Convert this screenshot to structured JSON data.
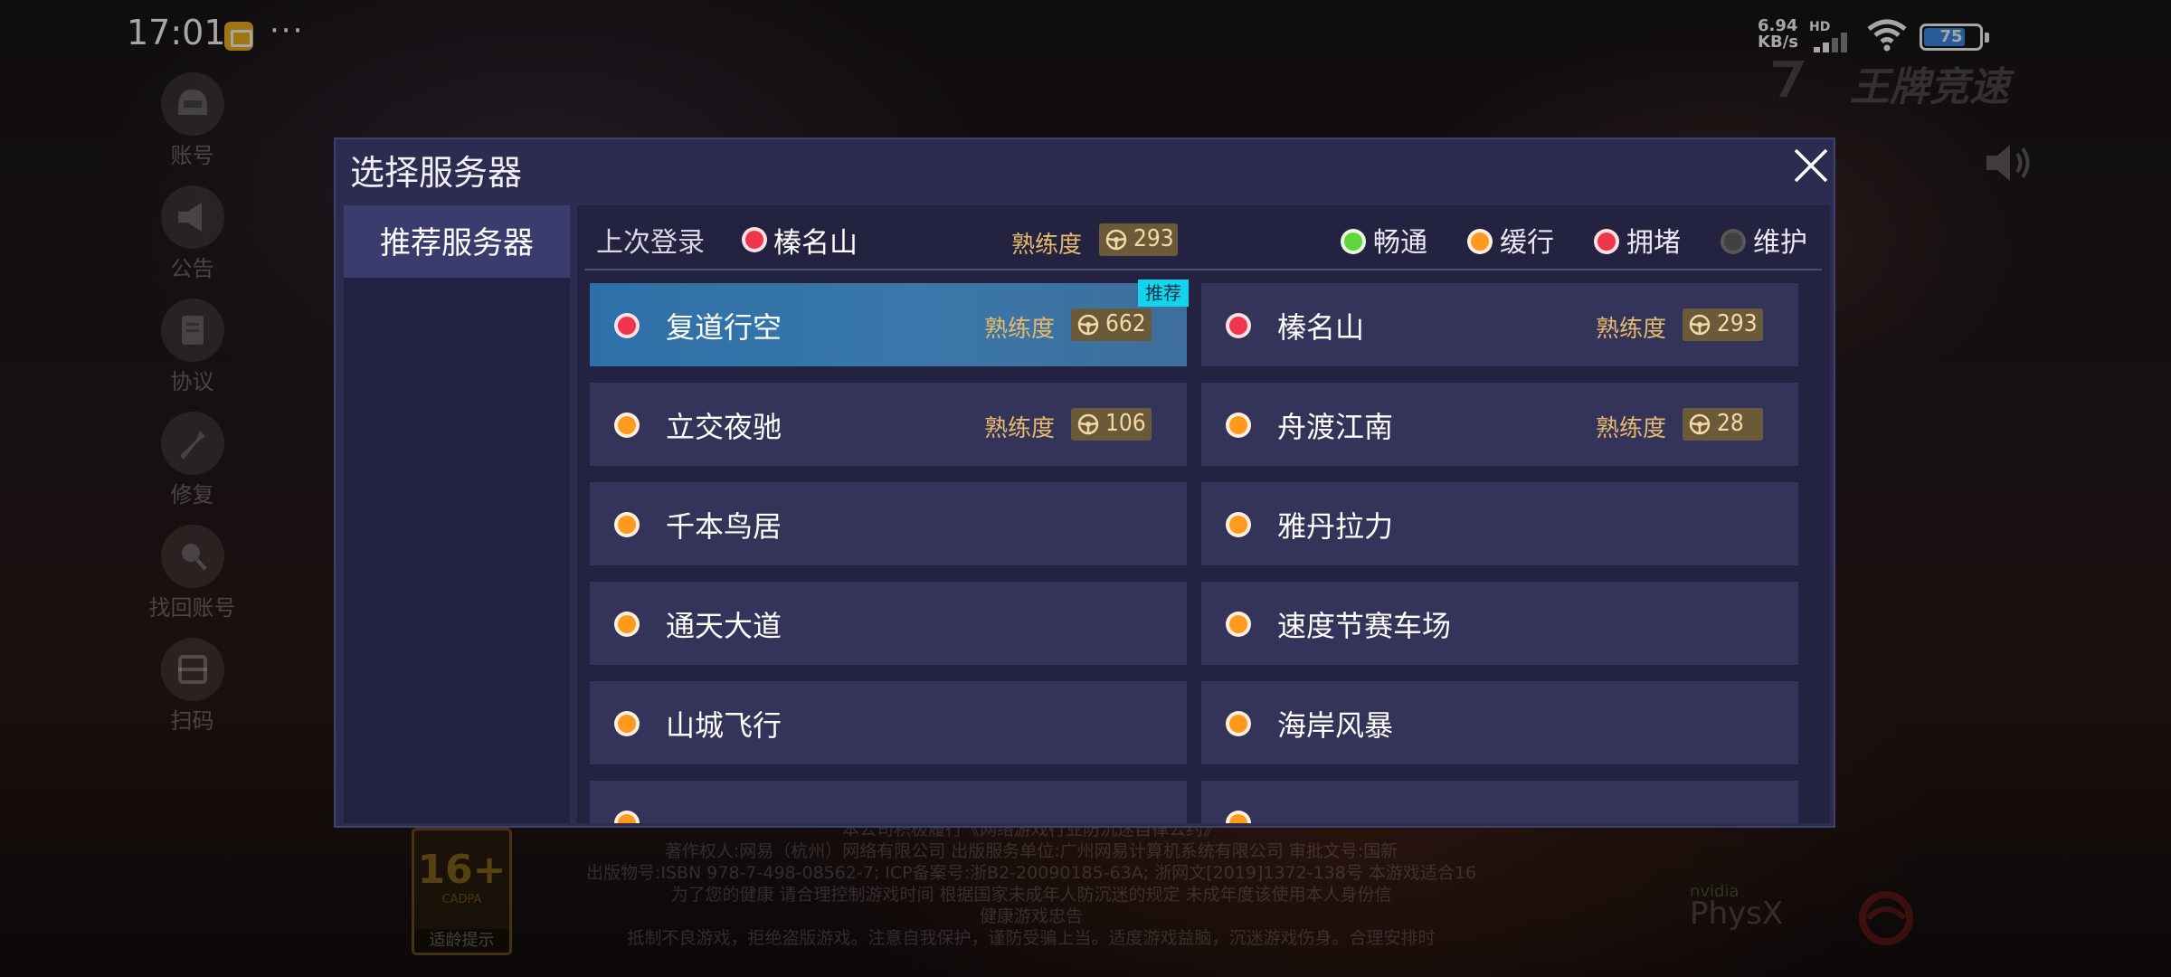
{
  "status_bar": {
    "time": "17:01",
    "more": "···",
    "net_speed_value": "6.94",
    "net_speed_unit": "KB/s",
    "network_type": "HD",
    "battery_level": "75",
    "battery_fraction": 0.75
  },
  "background": {
    "brand": "王牌竞速",
    "side_menu": [
      {
        "label": "账号",
        "icon": "helmet-icon"
      },
      {
        "label": "公告",
        "icon": "megaphone-icon"
      },
      {
        "label": "协议",
        "icon": "document-icon"
      },
      {
        "label": "修复",
        "icon": "wrench-icon"
      },
      {
        "label": "找回账号",
        "icon": "account-search-icon"
      },
      {
        "label": "扫码",
        "icon": "scan-icon"
      }
    ],
    "rating": {
      "age": "16+",
      "org": "CADPA",
      "tip": "适龄提示"
    },
    "legal_lines": [
      "本公司积极履行《网络游戏行业防沉迷自律公约》",
      "著作权人:网易（杭州）网络有限公司 出版服务单位:广州网易计算机系统有限公司 审批文号:国新",
      "出版物号:ISBN 978-7-498-08562-7; ICP备案号:浙B2-20090185-63A; 浙网文[2019]1372-138号 本游戏适合16",
      "为了您的健康 请合理控制游戏时间 根据国家未成年人防沉迷的规定 未成年度该使用本人身份信",
      "健康游戏忠告",
      "抵制不良游戏，拒绝盗版游戏。注意自我保护，谨防受骗上当。适度游戏益脑，沉迷游戏伤身。合理安排时"
    ],
    "physx_brand": "nvidia",
    "physx": "PhysX"
  },
  "dialog": {
    "title": "选择服务器",
    "left_tabs": [
      {
        "label": "推荐服务器",
        "selected": true
      }
    ],
    "last_login_label": "上次登录",
    "last_login_server": "榛名山",
    "last_login_status_color": "#f0364f",
    "proficiency_label": "熟练度",
    "last_login_proficiency": "293",
    "legend": [
      {
        "label": "畅通",
        "color": "#62d63a"
      },
      {
        "label": "缓行",
        "color": "#ff9a1f"
      },
      {
        "label": "拥堵",
        "color": "#f0364f"
      },
      {
        "label": "维护",
        "color": "#404040"
      }
    ],
    "servers": [
      {
        "name": "复道行空",
        "status_color": "#f0364f",
        "proficiency": "662",
        "recommended_tag": "推荐",
        "selected": true
      },
      {
        "name": "榛名山",
        "status_color": "#f0364f",
        "proficiency": "293"
      },
      {
        "name": "立交夜驰",
        "status_color": "#ff9a1f",
        "proficiency": "106"
      },
      {
        "name": "舟渡江南",
        "status_color": "#ff9a1f",
        "proficiency": "28"
      },
      {
        "name": "千本鸟居",
        "status_color": "#ff9a1f"
      },
      {
        "name": "雅丹拉力",
        "status_color": "#ff9a1f"
      },
      {
        "name": "通天大道",
        "status_color": "#ff9a1f"
      },
      {
        "name": "速度节赛车场",
        "status_color": "#ff9a1f"
      },
      {
        "name": "山城飞行",
        "status_color": "#ff9a1f"
      },
      {
        "name": "海岸风暴",
        "status_color": "#ff9a1f"
      },
      {
        "name": "",
        "status_color": "#ff9a1f"
      },
      {
        "name": "",
        "status_color": "#ff9a1f"
      }
    ]
  }
}
